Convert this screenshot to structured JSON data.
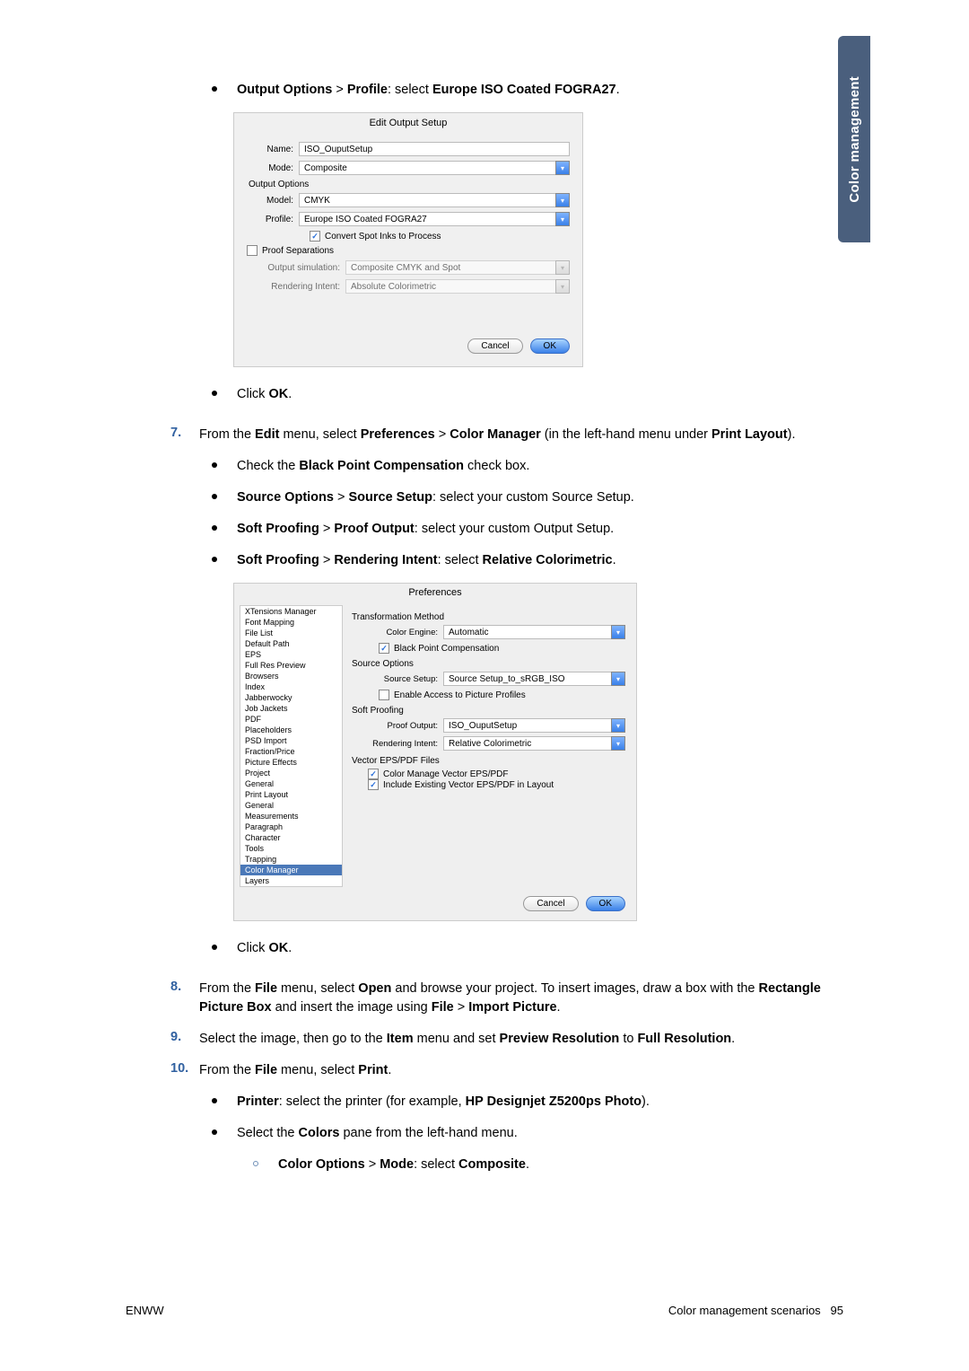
{
  "side_tab": "Color management",
  "lines": {
    "l1_a": "Output Options",
    "l1_b": "Profile",
    "l1_c": "Europe ISO Coated FOGRA27",
    "l2": "OK",
    "s7n": "7.",
    "s7_a": "Edit",
    "s7_b": "Preferences",
    "s7_c": "Color Manager",
    "s7_d": "Print Layout",
    "l7a": "Black Point Compensation",
    "l7b_a": "Source Options",
    "l7b_b": "Source Setup",
    "l7c_a": "Soft Proofing",
    "l7c_b": "Proof Output",
    "l7d_a": "Soft Proofing",
    "l7d_b": "Rendering Intent",
    "l7d_c": "Relative Colorimetric",
    "l8": "OK",
    "s8n": "8.",
    "s8_a": "File",
    "s8_b": "Open",
    "s8_c": "Rectangle Picture Box",
    "s8_d": "File",
    "s8_e": "Import Picture",
    "s9n": "9.",
    "s9_a": "Item",
    "s9_b": "Preview Resolution",
    "s9_c": "Full Resolution",
    "s10n": "10.",
    "s10_a": "File",
    "s10_b": "Print",
    "l10a_a": "Printer",
    "l10a_b": "HP Designjet Z5200ps Photo",
    "l10b": "Colors",
    "l10c_a": "Color Options",
    "l10c_b": "Mode",
    "l10c_c": "Composite"
  },
  "dialog1": {
    "title": "Edit Output Setup",
    "name_label": "Name:",
    "name_val": "ISO_OuputSetup",
    "mode_label": "Mode:",
    "mode_val": "Composite",
    "options_title": "Output Options",
    "model_label": "Model:",
    "model_val": "CMYK",
    "profile_label": "Profile:",
    "profile_val": "Europe ISO Coated FOGRA27",
    "convert_cb": "Convert Spot Inks to Process",
    "proof_cb": "Proof Separations",
    "outsim_label": "Output simulation:",
    "outsim_val": "Composite CMYK and Spot",
    "render_label": "Rendering Intent:",
    "render_val": "Absolute Colorimetric",
    "cancel": "Cancel",
    "ok": "OK"
  },
  "dialog2": {
    "title": "Preferences",
    "menu": [
      "XTensions Manager",
      "Font Mapping",
      "File List",
      "Default Path",
      "EPS",
      "Full Res Preview",
      "Browsers",
      "Index",
      "Jabberwocky",
      "Job Jackets",
      "PDF",
      "Placeholders",
      "PSD Import",
      "Fraction/Price",
      "Picture Effects",
      "Project",
      "  General",
      "Print Layout",
      "  General",
      "  Measurements",
      "  Paragraph",
      "  Character",
      "  Tools",
      "  Trapping",
      "  Color Manager",
      "  Layers"
    ],
    "menu_hl_index": 24,
    "trans_title": "Transformation Method",
    "engine_label": "Color Engine:",
    "engine_val": "Automatic",
    "bpc_cb": "Black Point Compensation",
    "src_title": "Source Options",
    "src_label": "Source Setup:",
    "src_val": "Source Setup_to_sRGB_ISO",
    "enable_cb": "Enable Access to Picture Profiles",
    "proof_title": "Soft Proofing",
    "proof_label": "Proof Output:",
    "proof_val": "ISO_OuputSetup",
    "rend_label": "Rendering Intent:",
    "rend_val": "Relative Colorimetric",
    "vec_title": "Vector EPS/PDF Files",
    "vec_cb1": "Color Manage Vector EPS/PDF",
    "vec_cb2": "Include Existing Vector EPS/PDF in Layout",
    "cancel": "Cancel",
    "ok": "OK"
  },
  "footer": {
    "left": "ENWW",
    "right_a": "Color management scenarios",
    "page": "95"
  }
}
